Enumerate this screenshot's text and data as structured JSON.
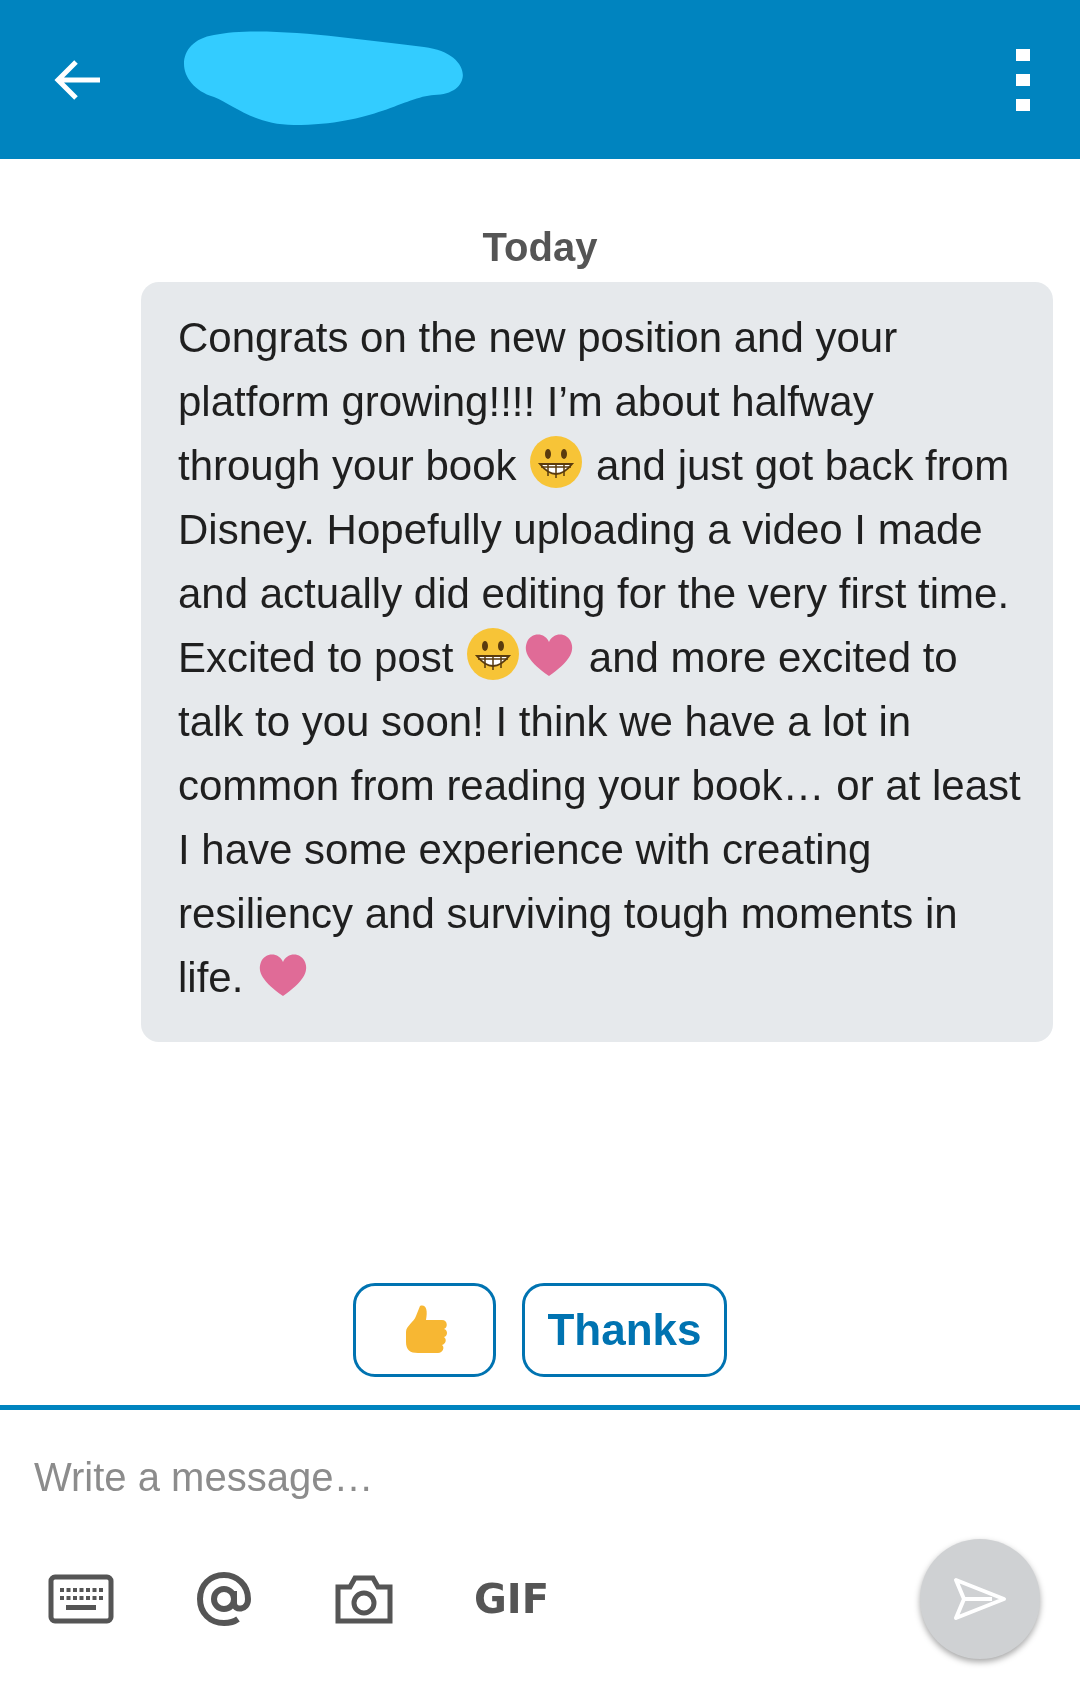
{
  "header": {
    "kind": "redacted"
  },
  "date_label": "Today",
  "message": {
    "parts": [
      {
        "kind": "text",
        "text": "Congrats on the new position and your platform growing!!!!  I’m about halfway through your book "
      },
      {
        "kind": "grin"
      },
      {
        "kind": "text",
        "text": " and just got back from Disney.   Hopefully uploading a video I made and actually did editing for the very first time. Excited to post "
      },
      {
        "kind": "grin"
      },
      {
        "kind": "heart"
      },
      {
        "kind": "text",
        "text": " and more excited to talk to you soon!  I think we have a lot in common from reading your book… or at least I have some experience with creating resiliency and surviving tough moments in life.  "
      },
      {
        "kind": "heart"
      }
    ]
  },
  "quick_replies": [
    {
      "kind": "thumbs"
    },
    {
      "kind": "text",
      "text": "Thanks"
    }
  ],
  "composer": {
    "placeholder": "Write a message…",
    "tools": [
      {
        "kind": "keyboard"
      },
      {
        "kind": "at"
      },
      {
        "kind": "camera"
      },
      {
        "kind": "text",
        "text": "GIF"
      }
    ]
  }
}
